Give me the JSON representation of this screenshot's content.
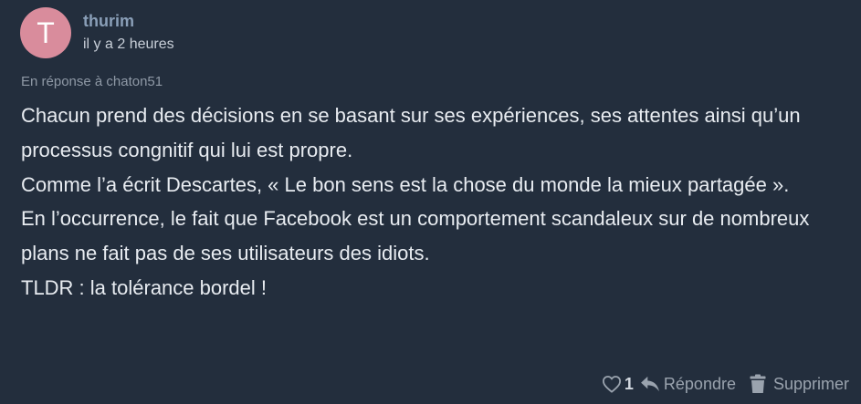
{
  "comment": {
    "author": {
      "initial": "T",
      "username": "thurim",
      "avatar_color": "#d98c9c"
    },
    "timestamp": "il y a 2 heures",
    "reply_to": "En réponse à chaton51",
    "paragraphs": [
      "Chacun prend des décisions en se basant sur ses expériences, ses attentes ainsi qu’un processus congnitif qui lui est propre.",
      "Comme l’a écrit Descartes, « Le bon sens est la chose du monde la mieux partagée ».",
      "En l’occurrence, le fait que Facebook est un comportement scandaleux sur de nombreux plans ne fait pas de ses utilisateurs des idiots.",
      "TLDR : la tolérance bordel !"
    ],
    "actions": {
      "like_icon": "heart-icon",
      "like_count": "1",
      "reply_icon": "reply-arrow-icon",
      "reply_label": "Répondre",
      "delete_icon": "trash-icon",
      "delete_label": "Supprimer"
    }
  },
  "colors": {
    "background": "#232e3d",
    "username": "#8a9fb8",
    "body_text": "#e8ecf1",
    "muted_text": "#8f99a6",
    "action_text": "#9aa3ae"
  }
}
